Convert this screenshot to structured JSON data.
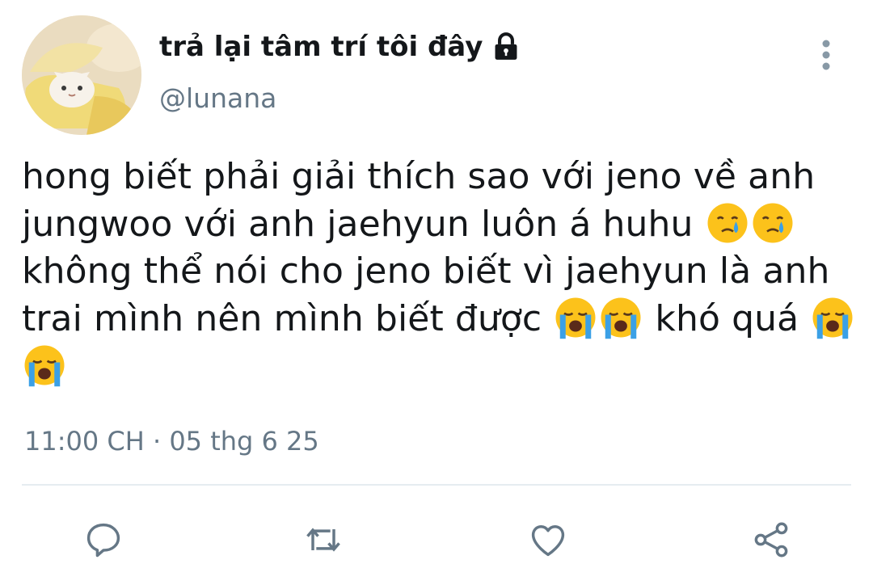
{
  "user": {
    "display_name": "trả lại tâm trí tôi đây",
    "handle": "@lunana",
    "protected_icon": "lock-icon",
    "avatar": "cat-in-banana-avatar"
  },
  "tweet": {
    "lines": [
      {
        "text": "hong biết phải giải thích sao với jeno về anh",
        "emojis_after": []
      },
      {
        "text": "jungwoo với anh jaehyun luôn á huhu ",
        "emojis_after": [
          "face-holding-back-tears",
          "face-holding-back-tears"
        ]
      },
      {
        "text": "không thể nói cho jeno biết vì jaehyun là anh",
        "emojis_after": []
      },
      {
        "text": "trai mình nên mình biết được ",
        "emojis_after": [
          "loudly-crying-face",
          "loudly-crying-face"
        ],
        "text_after": " khó quá ",
        "emojis_end": [
          "loudly-crying-face"
        ]
      },
      {
        "text": "",
        "emojis_after": [
          "loudly-crying-face"
        ]
      }
    ]
  },
  "timestamp": "11:00 CH · 05 thg 6 25",
  "actions": {
    "reply_icon": "reply-icon",
    "retweet_icon": "retweet-icon",
    "like_icon": "heart-icon",
    "share_icon": "share-icon",
    "more_icon": "more-vertical-icon"
  },
  "colors": {
    "text": "#14171a",
    "secondary": "#657786",
    "divider": "#e6ecf0",
    "icon": "#657786"
  }
}
